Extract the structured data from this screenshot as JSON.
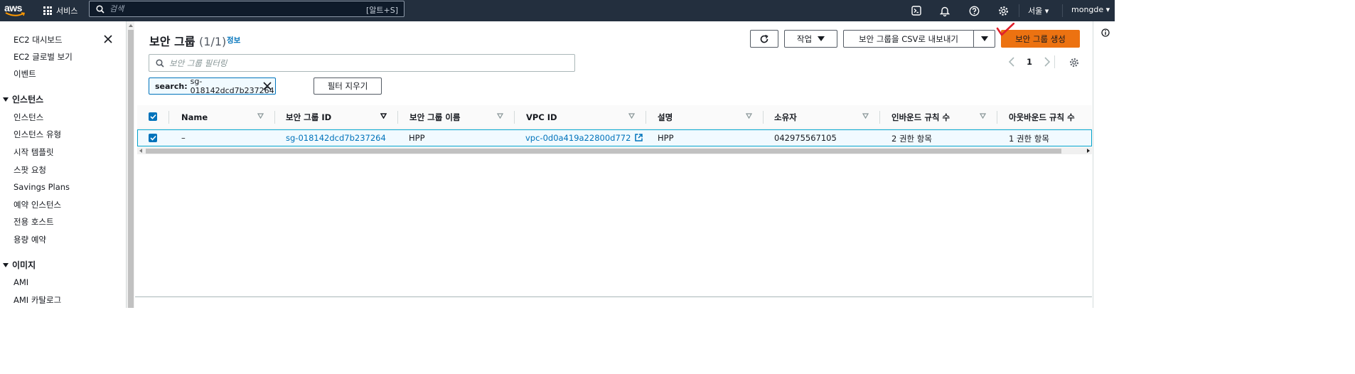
{
  "topbar": {
    "logo": "aws",
    "services_label": "서비스",
    "search_placeholder": "검색",
    "search_shortcut": "[알트+S]",
    "region": "서울",
    "account": "mongde"
  },
  "sidebar": {
    "items_top": [
      "EC2 대시보드",
      "EC2 글로벌 보기",
      "이벤트"
    ],
    "section_instances": "인스턴스",
    "instances_items": [
      "인스턴스",
      "인스턴스 유형",
      "시작 템플릿",
      "스팟 요청",
      "Savings Plans",
      "예약 인스턴스",
      "전용 호스트",
      "용량 예약"
    ],
    "section_images": "이미지",
    "images_items": [
      "AMI",
      "AMI 카탈로그"
    ]
  },
  "main": {
    "title": "보안 그룹",
    "count": "(1/1)",
    "info": "정보",
    "actions_label": "작업",
    "export_label": "보안 그룹을 CSV로 내보내기",
    "create_label": "보안 그룹 생성",
    "filter_placeholder": "보안 그룹 필터링",
    "token_key": "search:",
    "token_value": "sg-018142dcd7b237264",
    "clear_filters": "필터 지우기",
    "page": "1"
  },
  "table": {
    "columns": [
      "Name",
      "보안 그룹 ID",
      "보안 그룹 이름",
      "VPC ID",
      "설명",
      "소유자",
      "인바운드 규칙 수",
      "아웃바운드 규칙 수"
    ],
    "rows": [
      {
        "name": "–",
        "group_id": "sg-018142dcd7b237264",
        "group_name": "HPP",
        "vpc_id": "vpc-0d0a419a22800d772",
        "description": "HPP",
        "owner": "042975567105",
        "inbound": "2 권한 항목",
        "outbound": "1 권한 항목"
      }
    ]
  },
  "colors": {
    "topbar": "#232f3e",
    "primary": "#ec7211",
    "link": "#0073bb"
  }
}
